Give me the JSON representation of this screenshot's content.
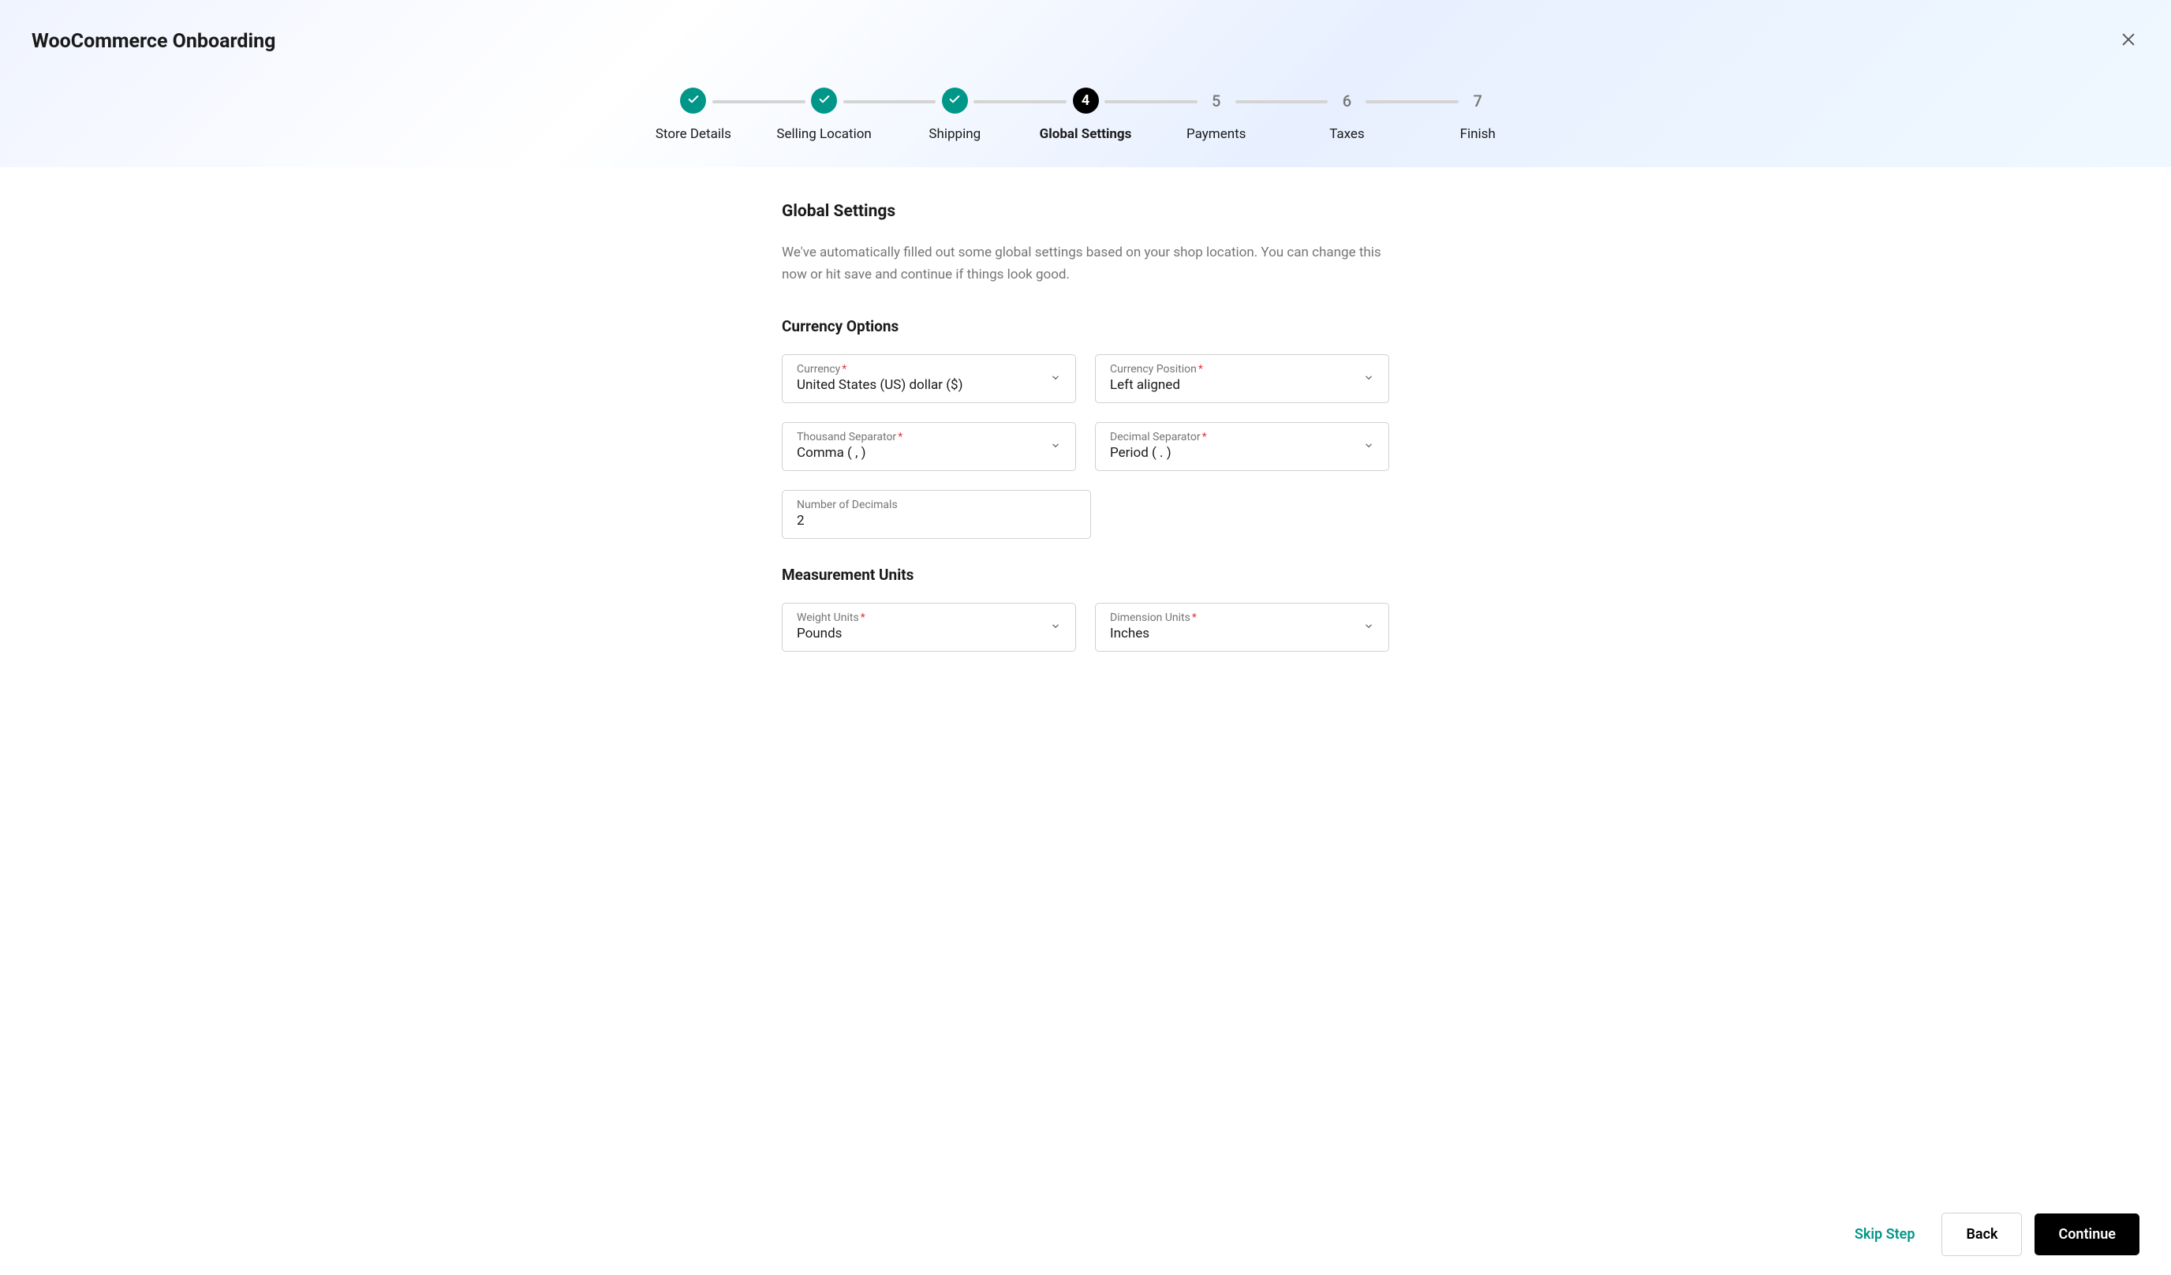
{
  "header": {
    "title": "WooCommerce Onboarding"
  },
  "stepper": {
    "steps": [
      {
        "label": "Store Details",
        "state": "completed"
      },
      {
        "label": "Selling Location",
        "state": "completed"
      },
      {
        "label": "Shipping",
        "state": "completed"
      },
      {
        "label": "Global Settings",
        "state": "active",
        "number": "4"
      },
      {
        "label": "Payments",
        "state": "future",
        "number": "5"
      },
      {
        "label": "Taxes",
        "state": "future",
        "number": "6"
      },
      {
        "label": "Finish",
        "state": "future",
        "number": "7"
      }
    ]
  },
  "content": {
    "heading": "Global Settings",
    "description": "We've automatically filled out some global settings based on your shop location. You can change this now or hit save and continue if things look good."
  },
  "sections": {
    "currency": {
      "heading": "Currency Options",
      "fields": {
        "currency": {
          "label": "Currency",
          "required": true,
          "value": "United States (US) dollar ($)"
        },
        "currency_position": {
          "label": "Currency Position",
          "required": true,
          "value": "Left aligned"
        },
        "thousand_separator": {
          "label": "Thousand Separator",
          "required": true,
          "value": "Comma ( , )"
        },
        "decimal_separator": {
          "label": "Decimal Separator",
          "required": true,
          "value": "Period ( . )"
        },
        "number_of_decimals": {
          "label": "Number of Decimals",
          "required": false,
          "value": "2"
        }
      }
    },
    "measurement": {
      "heading": "Measurement Units",
      "fields": {
        "weight": {
          "label": "Weight Units",
          "required": true,
          "value": "Pounds"
        },
        "dimension": {
          "label": "Dimension Units",
          "required": true,
          "value": "Inches"
        }
      }
    }
  },
  "footer": {
    "skip": "Skip Step",
    "back": "Back",
    "continue": "Continue"
  }
}
